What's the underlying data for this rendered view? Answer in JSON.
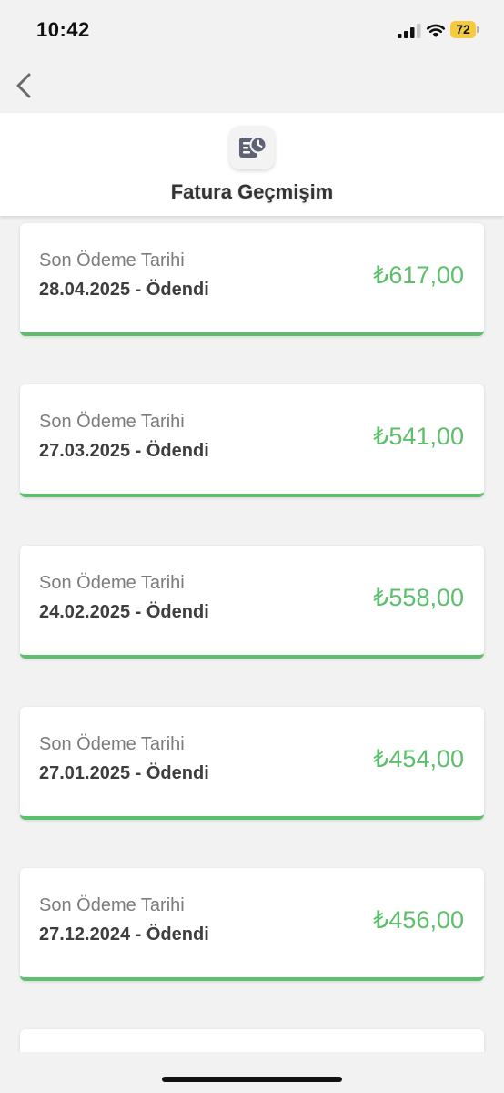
{
  "status_bar": {
    "time": "10:42",
    "battery_level": "72",
    "battery_color": "#f5cb3c"
  },
  "nav": {
    "back_icon": "chevron-left-icon"
  },
  "header": {
    "title": "Fatura Geçmişim",
    "icon": "bill-history-icon"
  },
  "bills": [
    {
      "label": "Son Ödeme Tarihi",
      "date_status": "28.04.2025 - Ödendi",
      "amount": "₺617,00"
    },
    {
      "label": "Son Ödeme Tarihi",
      "date_status": "27.03.2025 - Ödendi",
      "amount": "₺541,00"
    },
    {
      "label": "Son Ödeme Tarihi",
      "date_status": "24.02.2025 - Ödendi",
      "amount": "₺558,00"
    },
    {
      "label": "Son Ödeme Tarihi",
      "date_status": "27.01.2025 - Ödendi",
      "amount": "₺454,00"
    },
    {
      "label": "Son Ödeme Tarihi",
      "date_status": "27.12.2024 - Ödendi",
      "amount": "₺456,00"
    },
    {
      "label": "",
      "date_status": "",
      "amount": ""
    }
  ],
  "colors": {
    "paid_green": "#5cbf6c",
    "background": "#f2f2f2"
  }
}
